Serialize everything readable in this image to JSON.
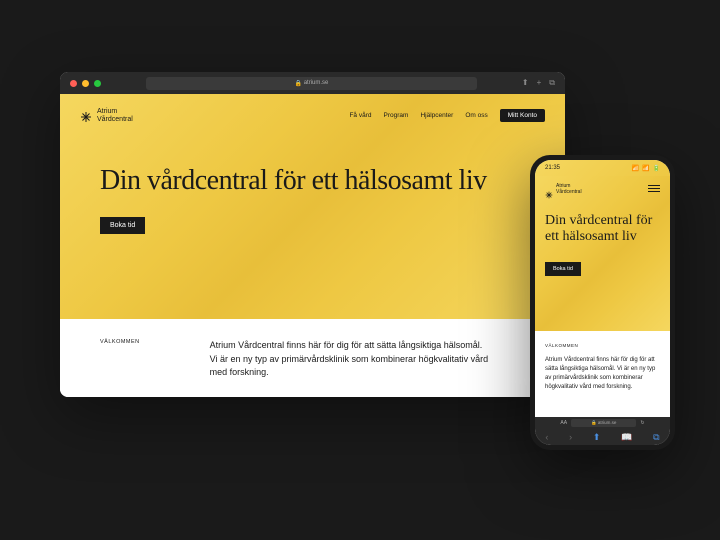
{
  "browser": {
    "url": "atrium.se"
  },
  "brand": {
    "line1": "Atrium",
    "line2": "Vårdcentral"
  },
  "nav": {
    "items": [
      "Få vård",
      "Program",
      "Hjälpcenter",
      "Om oss"
    ],
    "account": "Mitt Konto"
  },
  "hero": {
    "headline": "Din vårdcentral för ett hälsosamt liv",
    "headline_mobile": "Din vårdcentral för ett hälsosamt liv",
    "cta": "Boka tid"
  },
  "intro": {
    "label": "VÄLKOMMEN",
    "text": "Atrium Vårdcentral finns här för dig för att sätta långsiktiga hälsomål. Vi är en ny typ av primärvårdsklinik som kombinerar högkvalitativ vård med forskning."
  },
  "mobile": {
    "time": "21:35",
    "url": "atrium.se",
    "aa": "AA"
  }
}
